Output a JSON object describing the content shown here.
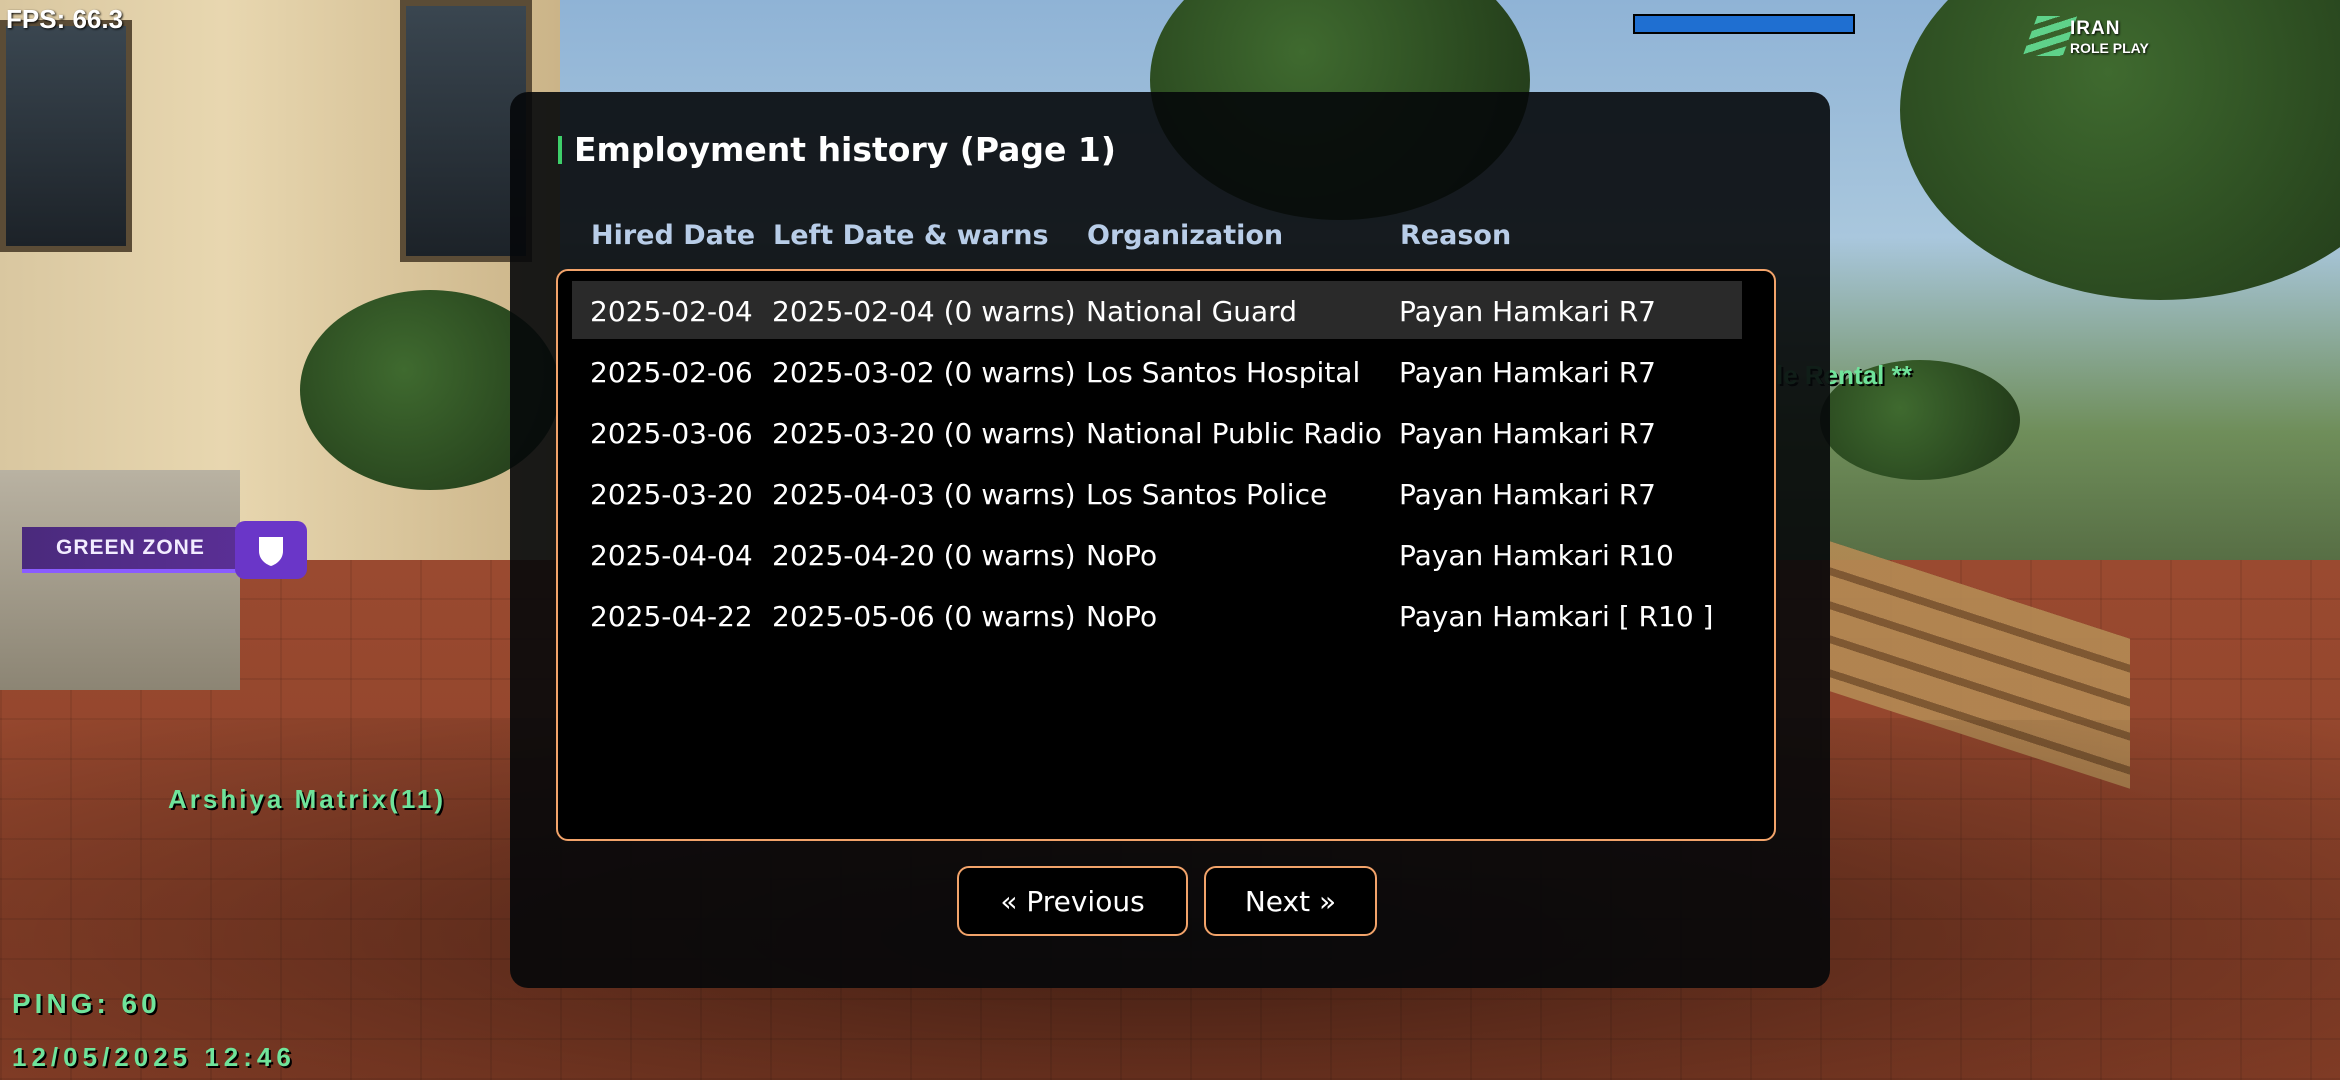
{
  "hud": {
    "fps": "FPS: 66.3",
    "logo_line1": "IRAN",
    "logo_line2": "ROLE PLAY",
    "zone_label": "GREEN ZONE",
    "player_name": "Arshiya Matrix(11)",
    "rental_text": "le Rental **",
    "ping": "PING: 60",
    "datetime": "12/05/2025 12:46",
    "health_fraction": 1.0,
    "colors": {
      "hud_green": "#6fe39a",
      "zone_purple": "#5a2f95",
      "health_blue": "#1f6fd1"
    }
  },
  "dialog": {
    "title": "Employment history (Page 1)",
    "columns": [
      "Hired Date",
      "Left Date & warns",
      "Organization",
      "Reason"
    ],
    "rows": [
      [
        "2025-02-04",
        "2025-02-04 (0 warns)",
        "National Guard",
        "Payan Hamkari R7"
      ],
      [
        "2025-02-06",
        "2025-03-02 (0 warns)",
        "Los Santos Hospital",
        "Payan Hamkari R7"
      ],
      [
        "2025-03-06",
        "2025-03-20 (0 warns)",
        "National Public Radio",
        "Payan Hamkari R7"
      ],
      [
        "2025-03-20",
        "2025-04-03 (0 warns)",
        "Los Santos Police",
        "Payan Hamkari R7"
      ],
      [
        "2025-04-04",
        "2025-04-20 (0 warns)",
        "NoPo",
        "Payan Hamkari R10"
      ],
      [
        "2025-04-22",
        "2025-05-06 (0 warns)",
        "NoPo",
        "Payan Hamkari [ R10 ]"
      ]
    ],
    "selected_row": 0,
    "prev_label": "« Previous",
    "next_label": "Next »",
    "colors": {
      "accent": "#f2a36a",
      "header": "#b8cde8",
      "title_accent": "#3ecf6a"
    }
  }
}
